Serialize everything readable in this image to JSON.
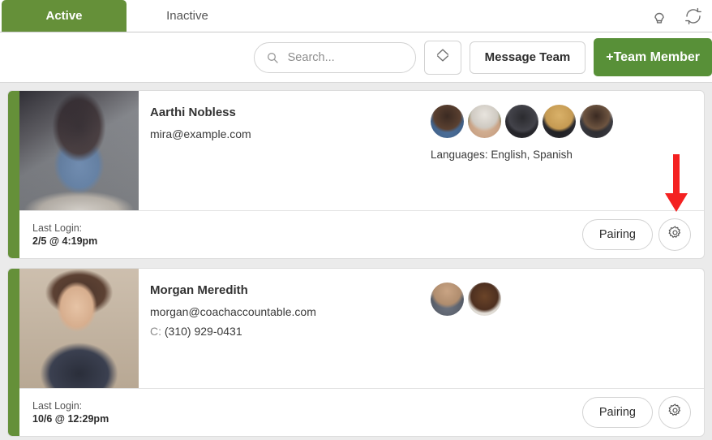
{
  "tabs": [
    {
      "label": "Active",
      "active": true,
      "name": "tab-active"
    },
    {
      "label": "Inactive",
      "active": false,
      "name": "tab-inactive"
    }
  ],
  "header_icons": [
    {
      "name": "lightbulb-icon",
      "title": "Tips"
    },
    {
      "name": "refresh-icon",
      "title": "Refresh"
    }
  ],
  "toolbar": {
    "search_value": "",
    "search_placeholder": "Search...",
    "sort_icon": "sort-diamond-icon",
    "message_team_label": "Message Team",
    "add_team_member_label": "+Team Member"
  },
  "colors": {
    "accent_green": "#659039",
    "button_green": "#589038",
    "annotation_red": "#f42121",
    "page_background": "#ebebeb",
    "card_background": "#ffffff"
  },
  "annotation": {
    "type": "arrow",
    "direction": "down",
    "color": "#f42121",
    "points_at": "gear-button-card-1"
  },
  "cards": [
    {
      "name": "Aarthi Nobless",
      "email": "mira@example.com",
      "phone_label": "",
      "phone": "",
      "languages": "Languages: English, Spanish",
      "avatar_count": 5,
      "last_login_label": "Last Login:",
      "last_login_value": "2/5 @ 4:19pm",
      "pairing_label": "Pairing",
      "gear_icon": "gear-icon"
    },
    {
      "name": "Morgan Meredith",
      "email": "morgan@coachaccountable.com",
      "phone_label": "C:",
      "phone": "(310) 929-0431",
      "languages": "",
      "avatar_count": 2,
      "last_login_label": "Last Login:",
      "last_login_value": "10/6 @ 12:29pm",
      "pairing_label": "Pairing",
      "gear_icon": "gear-icon"
    }
  ]
}
